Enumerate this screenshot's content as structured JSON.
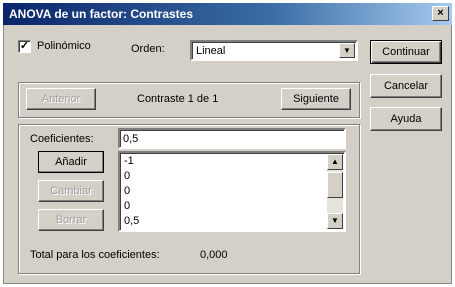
{
  "window": {
    "title": "ANOVA de un factor: Contrastes",
    "close_label": "×"
  },
  "polynomial": {
    "label": "Polinómico",
    "checked_mark": "✓"
  },
  "order": {
    "label": "Orden:",
    "value": "Lineal"
  },
  "side_buttons": {
    "continue": "Continuar",
    "cancel": "Cancelar",
    "help": "Ayuda"
  },
  "nav": {
    "previous": "Anterior",
    "status": "Contraste 1 de 1",
    "next": "Siguiente"
  },
  "coefficients": {
    "label": "Coeficientes:",
    "input_value": "0,5",
    "add": "Añadir",
    "change": "Cambiar",
    "delete": "Borrar",
    "list": [
      "-1",
      "0",
      "0",
      "0",
      "0,5"
    ],
    "total_label": "Total para los coeficientes:",
    "total_value": "0,000"
  }
}
